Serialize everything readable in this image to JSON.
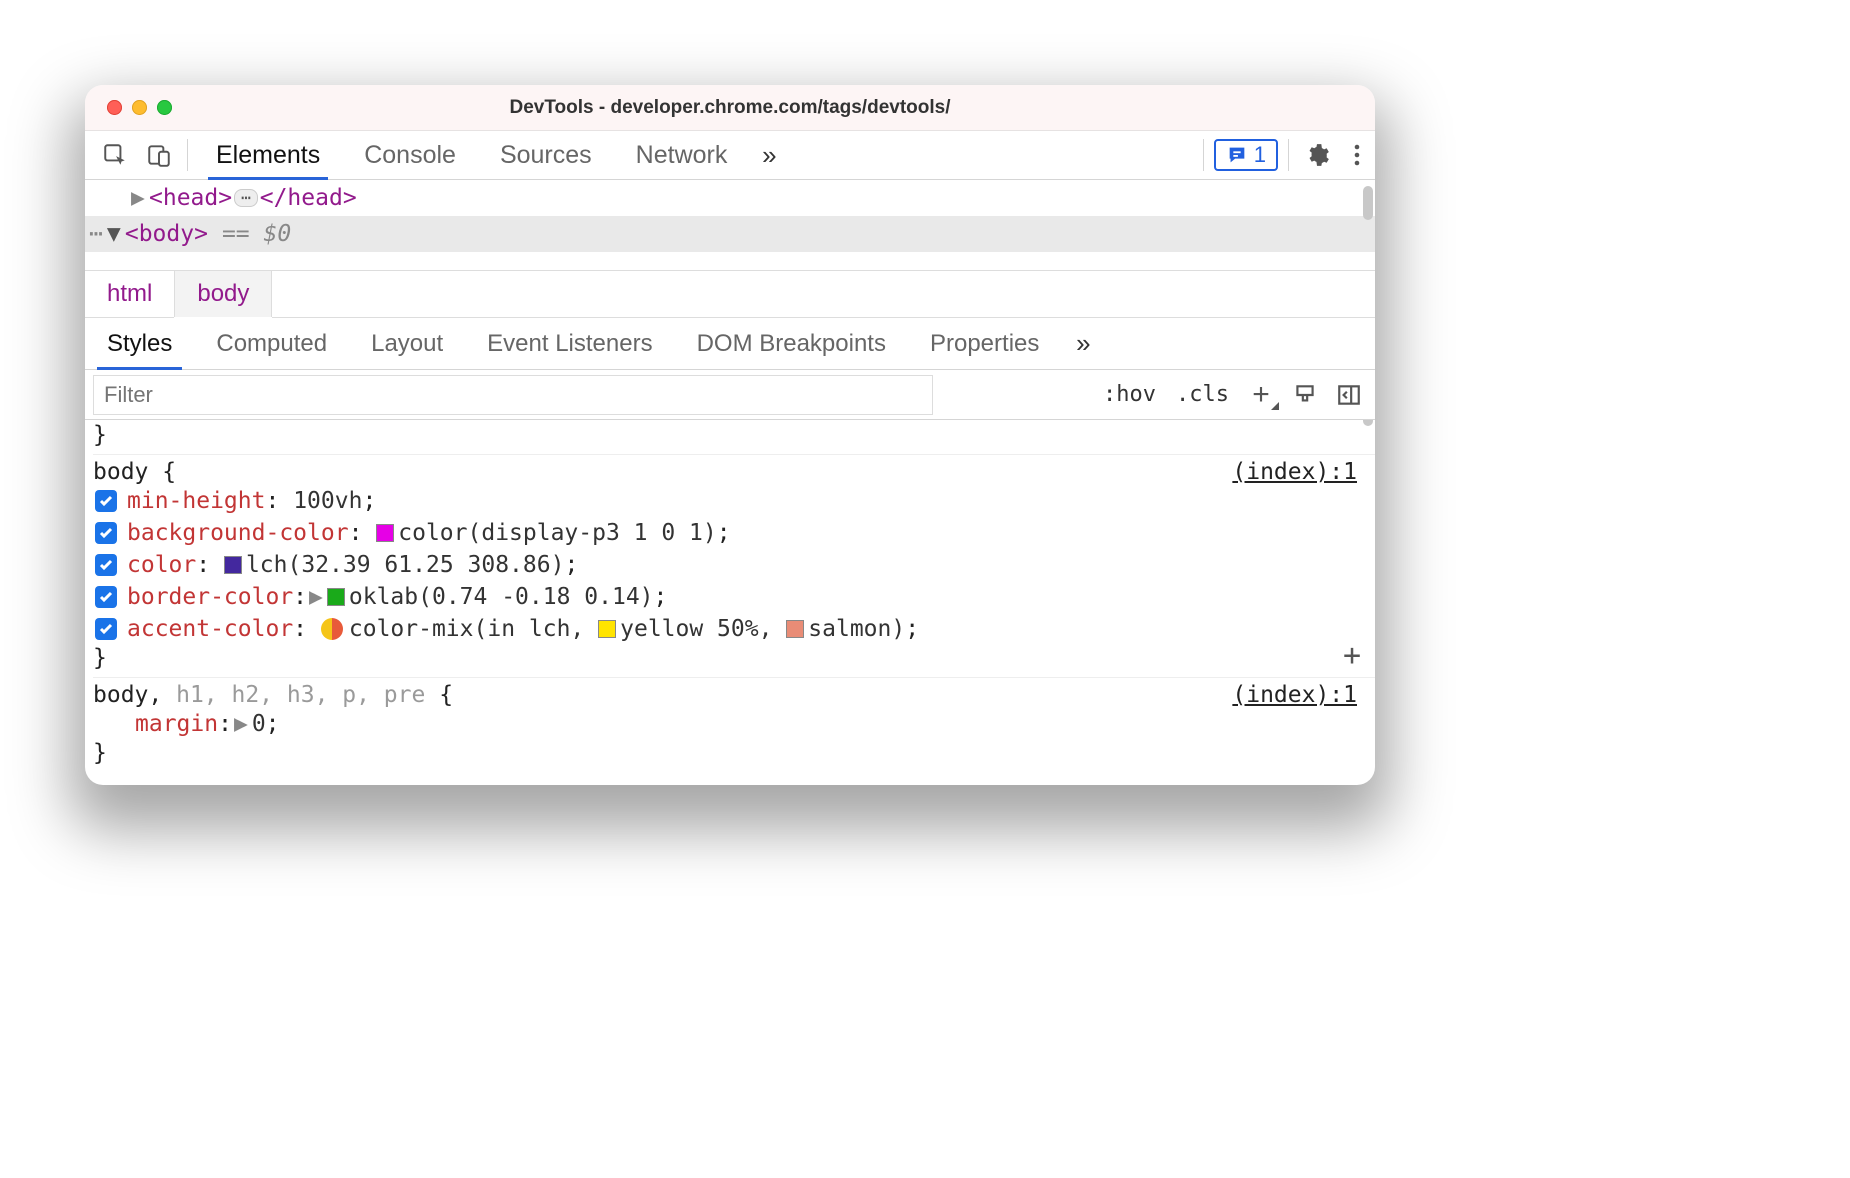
{
  "window": {
    "title": "DevTools - developer.chrome.com/tags/devtools/"
  },
  "toolbar": {
    "tabs": [
      "Elements",
      "Console",
      "Sources",
      "Network"
    ],
    "activeTab": "Elements",
    "more": "»",
    "issues_count": "1"
  },
  "dom": {
    "line1": {
      "arrow": "▶",
      "open": "<head>",
      "ellipsis": "⋯",
      "close": "</head>"
    },
    "line2": {
      "dots": "⋯",
      "arrow": "▼",
      "tag": "<body>",
      "ann_eq": "==",
      "ann_ref": "$0"
    }
  },
  "breadcrumbs": [
    "html",
    "body"
  ],
  "panel": {
    "tabs": [
      "Styles",
      "Computed",
      "Layout",
      "Event Listeners",
      "DOM Breakpoints",
      "Properties"
    ],
    "activeTab": "Styles",
    "more": "»"
  },
  "filterbar": {
    "placeholder": "Filter",
    "hov": ":hov",
    "cls": ".cls"
  },
  "styles": {
    "stray_close": "}",
    "rule1": {
      "selector": "body",
      "brace_open": " {",
      "brace_close": "}",
      "source": "(index):1",
      "decls": [
        {
          "prop": "min-height",
          "value_text": "100vh",
          "swatches": [],
          "expand": false
        },
        {
          "prop": "background-color",
          "value_text": "color(display-p3 1 0 1)",
          "swatches": [
            {
              "c": "#e600e6"
            }
          ],
          "expand": false
        },
        {
          "prop": "color",
          "value_text": "lch(32.39 61.25 308.86)",
          "swatches": [
            {
              "c": "#43289e"
            }
          ],
          "expand": false
        },
        {
          "prop": "border-color",
          "value_text": "oklab(0.74 -0.18 0.14)",
          "swatches": [
            {
              "c": "#1aaa1a"
            }
          ],
          "expand": true
        },
        {
          "prop": "accent-color",
          "value_text_parts": [
            "color-mix(in lch, ",
            {
              "sw": "#ffe400"
            },
            "yellow 50%, ",
            {
              "sw": "#e98c76"
            },
            "salmon)"
          ],
          "mix": true,
          "expand": false
        }
      ]
    },
    "rule2": {
      "selector_main": "body,",
      "selector_dim": " h1, h2, h3, p, pre",
      "brace_open": " {",
      "brace_close": "}",
      "source": "(index):1",
      "decl": {
        "prop": "margin",
        "value_text": "0",
        "expand": true
      }
    }
  }
}
